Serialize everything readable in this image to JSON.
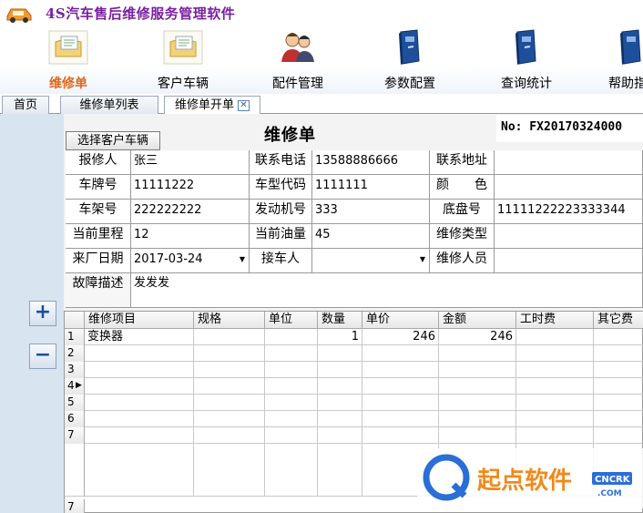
{
  "app": {
    "title": "4S汽车售后维修服务管理软件"
  },
  "nav": [
    {
      "label": "维修单",
      "icon": "folder-document-icon",
      "active": true
    },
    {
      "label": "客户车辆",
      "icon": "folder-document-icon",
      "active": false
    },
    {
      "label": "配件管理",
      "icon": "people-icon",
      "active": false
    },
    {
      "label": "参数配置",
      "icon": "book-icon",
      "active": false
    },
    {
      "label": "查询统计",
      "icon": "book-icon",
      "active": false
    },
    {
      "label": "帮助指",
      "icon": "book-icon",
      "active": false
    }
  ],
  "tabs": [
    {
      "label": "首页"
    },
    {
      "label": "维修单列表"
    },
    {
      "label": "维修单开单",
      "closable": true
    }
  ],
  "form": {
    "title": "维修单",
    "order_no": "No: FX20170324000",
    "pick_button": "选择客户车辆",
    "fields": {
      "reporter_label": "报修人",
      "reporter": "张三",
      "phone_label": "联系电话",
      "phone": "13588886666",
      "address_label": "联系地址",
      "address": "",
      "plate_label": "车牌号",
      "plate": "11111222",
      "model_label": "车型代码",
      "model": "1111111",
      "color_label": "颜　　色",
      "color": "",
      "vin_label": "车架号",
      "vin": "222222222",
      "engine_label": "发动机号",
      "engine": "333",
      "chassis_label": "底盘号",
      "chassis": "11111222223333344",
      "mileage_label": "当前里程",
      "mileage": "12",
      "fuel_label": "当前油量",
      "fuel": "45",
      "repair_type_label": "维修类型",
      "repair_type": "",
      "date_label": "来厂日期",
      "date": "2017-03-24",
      "receiver_label": "接车人",
      "receiver": "",
      "staff_label": "维修人员",
      "staff": "",
      "fault_label": "故障描述",
      "fault": "发发发"
    }
  },
  "detail": {
    "columns": [
      "维修项目",
      "规格",
      "单位",
      "数量",
      "单价",
      "金额",
      "工时费",
      "其它费"
    ],
    "rows": [
      {
        "no": "1",
        "item": "变换器",
        "spec": "",
        "unit": "",
        "qty": "1",
        "price": "246",
        "amount": "246",
        "labor": "",
        "other": ""
      },
      {
        "no": "2",
        "item": "",
        "spec": "",
        "unit": "",
        "qty": "",
        "price": "",
        "amount": "",
        "labor": "",
        "other": ""
      },
      {
        "no": "3",
        "item": "",
        "spec": "",
        "unit": "",
        "qty": "",
        "price": "",
        "amount": "",
        "labor": "",
        "other": ""
      },
      {
        "no": "4",
        "item": "",
        "spec": "",
        "unit": "",
        "qty": "",
        "price": "",
        "amount": "",
        "labor": "",
        "other": "",
        "current": true
      },
      {
        "no": "5",
        "item": "",
        "spec": "",
        "unit": "",
        "qty": "",
        "price": "",
        "amount": "",
        "labor": "",
        "other": ""
      },
      {
        "no": "6",
        "item": "",
        "spec": "",
        "unit": "",
        "qty": "",
        "price": "",
        "amount": "",
        "labor": "",
        "other": ""
      },
      {
        "no": "7",
        "item": "",
        "spec": "",
        "unit": "",
        "qty": "",
        "price": "",
        "amount": "",
        "labor": "",
        "other": ""
      }
    ],
    "footer_no": "7"
  },
  "side_buttons": {
    "add": "+",
    "remove": "−"
  },
  "watermark": {
    "brand": "起点软件",
    "site": "CNCRK",
    "domain": ".COM"
  },
  "colors": {
    "accent": "#e0661a",
    "title": "#7a1fa2",
    "panel": "#d9e4f1"
  }
}
